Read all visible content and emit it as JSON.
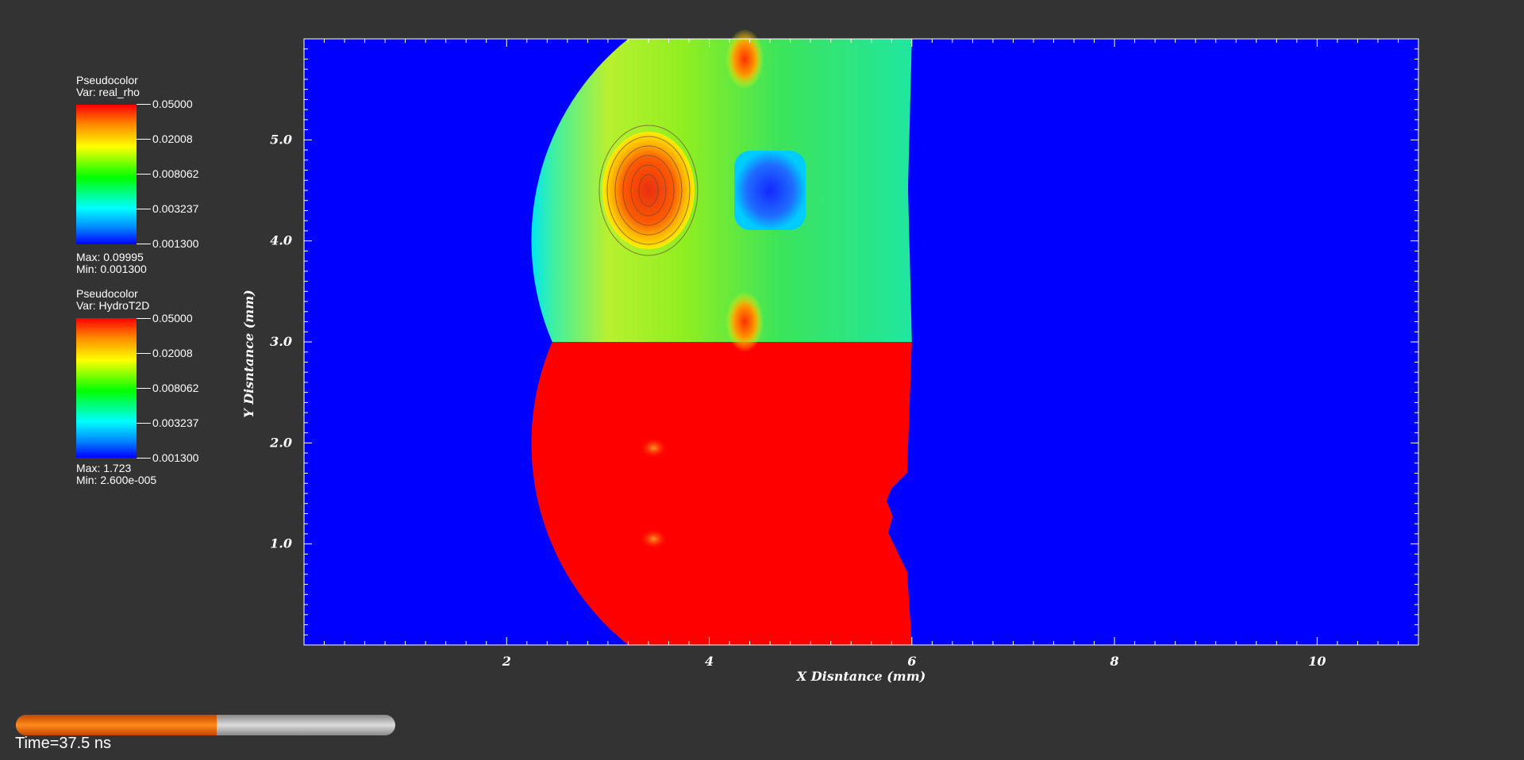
{
  "legends": [
    {
      "title": "Pseudocolor",
      "var": "Var: real_rho",
      "ticks": [
        "0.05000",
        "0.02008",
        "0.008062",
        "0.003237",
        "0.001300"
      ],
      "max": "Max:  0.09995",
      "min": "Min:  0.001300"
    },
    {
      "title": "Pseudocolor",
      "var": "Var: HydroT2D",
      "ticks": [
        "0.05000",
        "0.02008",
        "0.008062",
        "0.003237",
        "0.001300"
      ],
      "max": "Max:  1.723",
      "min": "Min:  2.600e-005"
    }
  ],
  "time_label": "Time=37.5 ns",
  "progress_fraction": 0.53,
  "chart_data": {
    "type": "heatmap",
    "title": "",
    "xlabel": "X Disntance (mm)",
    "ylabel": "Y Disntance (mm)",
    "xlim": [
      0,
      11
    ],
    "ylim": [
      0,
      6
    ],
    "x_ticks": [
      2,
      4,
      6,
      8,
      10
    ],
    "x_tick_labels": [
      "2",
      "4",
      "6",
      "8",
      "10"
    ],
    "y_ticks": [
      1,
      2,
      3,
      4,
      5
    ],
    "y_tick_labels": [
      "1.0",
      "2.0",
      "3.0",
      "4.0",
      "5.0"
    ],
    "colormap": [
      "#0000ff",
      "#00ffff",
      "#00ff00",
      "#ffff00",
      "#ff0000"
    ],
    "scale": "log",
    "upper_half_variable": "real_rho",
    "lower_half_variable": "HydroT2D",
    "split_y": 3.0,
    "shock_front": {
      "left_arc_center": [
        5.0,
        3.0
      ],
      "left_arc_radius": 2.55,
      "top_x": 3.2,
      "right_edge_x": 6.0,
      "right_notch_x": 5.75
    },
    "dense_blob_center": [
      3.4,
      4.5
    ],
    "cavity_center": [
      4.6,
      4.5
    ],
    "hot_spots": [
      [
        4.35,
        5.8
      ],
      [
        4.35,
        3.2
      ],
      [
        3.45,
        1.95
      ],
      [
        3.45,
        1.05
      ]
    ]
  },
  "colors": {
    "background": "#333333",
    "low": "#0000ff",
    "high": "#ff0000"
  }
}
